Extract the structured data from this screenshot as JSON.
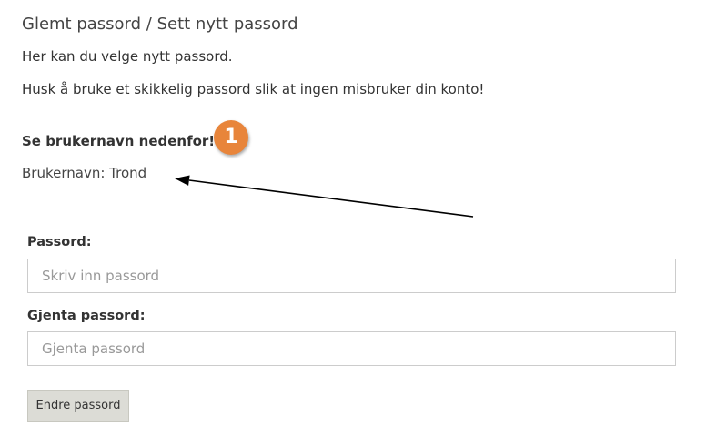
{
  "page": {
    "title": "Glemt passord / Sett nytt passord",
    "intro_line_1": "Her kan du velge nytt passord.",
    "intro_line_2": "Husk å bruke et skikkelig passord slik at ingen misbruker din konto!"
  },
  "username_section": {
    "heading": "Se brukernavn nedenfor!",
    "callout_number": "1",
    "callout_color": "#e8853b",
    "username_line": "Brukernavn: Trond"
  },
  "form": {
    "password_label": "Passord:",
    "password_placeholder": "Skriv inn passord",
    "password_value": "",
    "repeat_label": "Gjenta passord:",
    "repeat_placeholder": "Gjenta passord",
    "repeat_value": "",
    "submit_label": "Endre passord",
    "submit_bg_color": "#dcdcd6"
  },
  "annotation": {
    "arrow_icon": "arrow-left-icon",
    "arrow_color": "#000000"
  }
}
